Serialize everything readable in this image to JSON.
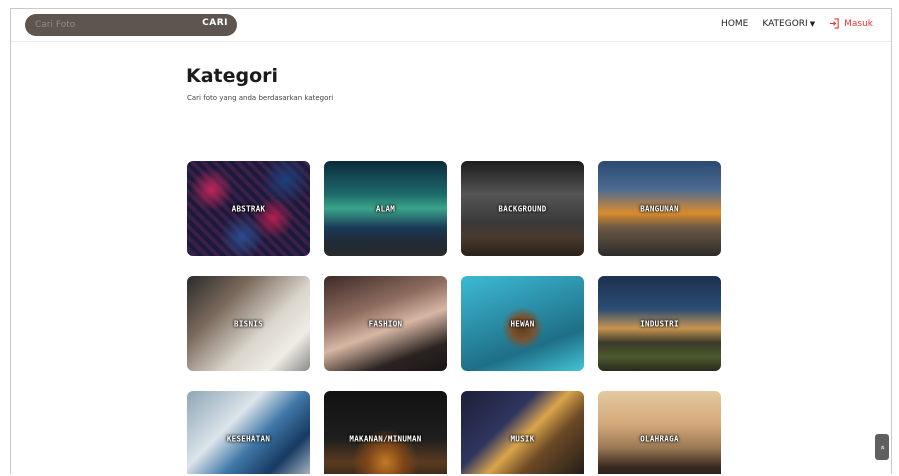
{
  "navbar": {
    "search_placeholder": "Cari Foto",
    "search_button": "CARI",
    "links": {
      "home": "HOME",
      "category": "KATEGORI",
      "login": "Masuk"
    }
  },
  "page": {
    "title": "Kategori",
    "subtitle": "Cari foto yang anda berdasarkan kategori"
  },
  "categories": [
    {
      "label": "ABSTRAK"
    },
    {
      "label": "ALAM"
    },
    {
      "label": "BACKGROUND"
    },
    {
      "label": "BANGUNAN"
    },
    {
      "label": "BISNIS"
    },
    {
      "label": "FASHION"
    },
    {
      "label": "HEWAN"
    },
    {
      "label": "INDUSTRI"
    },
    {
      "label": "KESEHATAN"
    },
    {
      "label": "MAKANAN/MINUMAN"
    },
    {
      "label": "MUSIK"
    },
    {
      "label": "OLAHRAGA"
    }
  ],
  "scroll_top": {
    "icon": "double-chevron-up-icon",
    "glyph": "»"
  },
  "colors": {
    "accent": "#e5352f",
    "search_bg": "#5e564e"
  }
}
